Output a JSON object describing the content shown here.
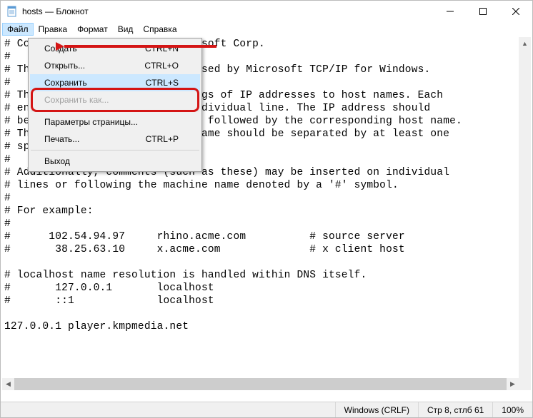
{
  "title": "hosts — Блокнот",
  "menubar": [
    "Файл",
    "Правка",
    "Формат",
    "Вид",
    "Справка"
  ],
  "dropdown": {
    "create": {
      "label": "Создать",
      "shortcut": "CTRL+N"
    },
    "open": {
      "label": "Открыть...",
      "shortcut": "CTRL+O"
    },
    "save": {
      "label": "Сохранить",
      "shortcut": "CTRL+S"
    },
    "saveas": {
      "label": "Сохранить как...",
      "shortcut": ""
    },
    "pagesetup": {
      "label": "Параметры страницы...",
      "shortcut": ""
    },
    "print": {
      "label": "Печать...",
      "shortcut": "CTRL+P"
    },
    "exit": {
      "label": "Выход",
      "shortcut": ""
    }
  },
  "editor_text": "# Copyright (c) 1993-2009 Microsoft Corp.\n#\n# This is a sample HOSTS file used by Microsoft TCP/IP for Windows.\n#\n# This file contains the mappings of IP addresses to host names. Each\n# entry should be kept on an individual line. The IP address should\n# be placed in the first column followed by the corresponding host name.\n# The IP address and the host name should be separated by at least one\n# space.\n#\n# Additionally, comments (such as these) may be inserted on individual\n# lines or following the machine name denoted by a '#' symbol.\n#\n# For example:\n#\n#      102.54.94.97     rhino.acme.com          # source server\n#       38.25.63.10     x.acme.com              # x client host\n\n# localhost name resolution is handled within DNS itself.\n#       127.0.0.1       localhost\n#       ::1             localhost\n\n127.0.0.1 player.kmpmedia.net",
  "statusbar": {
    "encoding": "Windows (CRLF)",
    "position": "Стр 8, стлб 61",
    "zoom": "100%"
  }
}
